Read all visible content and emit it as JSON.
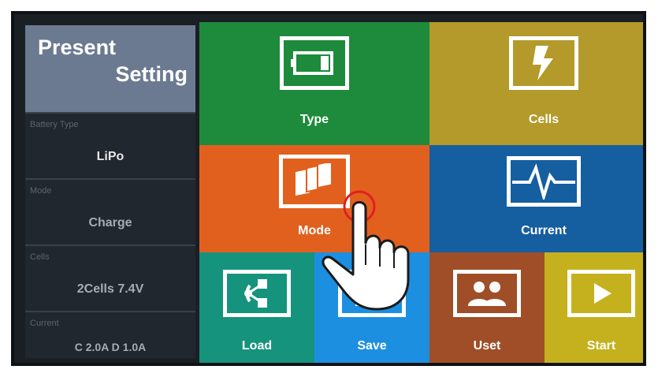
{
  "panel": {
    "title_line1": "Present",
    "title_line2": "Setting",
    "fields": [
      {
        "caption": "Battery Type",
        "value": "LiPo"
      },
      {
        "caption": "Mode",
        "value": "Charge"
      },
      {
        "caption": "Cells",
        "value": "2Cells  7.4V"
      },
      {
        "caption": "Current",
        "value": "C 2.0A  D 1.0A"
      }
    ]
  },
  "tiles": {
    "type": {
      "label": "Type",
      "icon": "battery-icon",
      "color": "#1e8a3c"
    },
    "cells": {
      "label": "Cells",
      "icon": "lightning-icon",
      "color": "#b39a2a"
    },
    "mode": {
      "label": "Mode",
      "icon": "cards-icon",
      "color": "#e2601e"
    },
    "current": {
      "label": "Current",
      "icon": "waveform-icon",
      "color": "#155ea0"
    },
    "load": {
      "label": "Load",
      "icon": "share-icon",
      "color": "#16937c"
    },
    "save": {
      "label": "Save",
      "icon": "save-icon",
      "color": "#1d8fe0"
    },
    "uset": {
      "label": "Uset",
      "icon": "users-icon",
      "color": "#a04e27"
    },
    "start": {
      "label": "Start",
      "icon": "play-icon",
      "color": "#c5b11e"
    }
  },
  "colors": {
    "value_text": "#e6e6e6",
    "value_dim": "#a6acb3"
  }
}
